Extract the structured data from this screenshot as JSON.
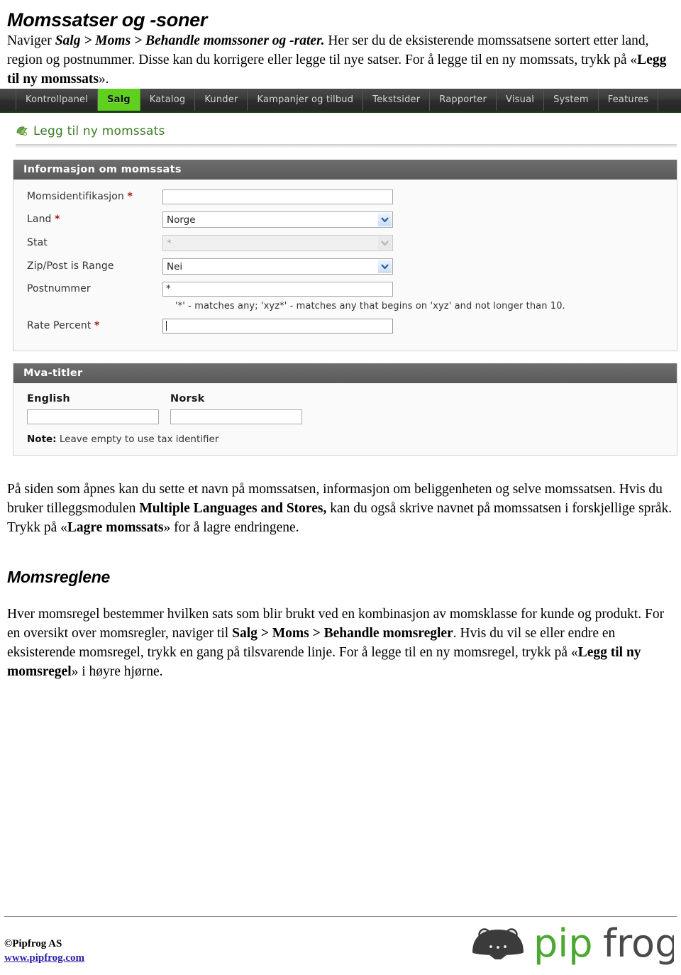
{
  "doc": {
    "title": "Momssatser og -soner",
    "intro": {
      "lead": "Naviger ",
      "path": "Salg > Moms > Behandle momssoner og -rater.",
      "rest": " Her ser du de eksisterende momssatsene sortert etter land, region og postnummer. Disse kan du korrigere eller legge til nye satser. For å legge til en ny momssats, trykk på «",
      "emph": "Legg til ny momssats",
      "tail": "»."
    },
    "mid_paragraph": {
      "part1": "På siden som åpnes kan du sette et navn på momssatsen, informasjon om beliggenheten og selve momssatsen. Hvis du bruker tilleggsmodulen ",
      "bold1": "Multiple Languages and Stores,",
      "part2": " kan du også skrive navnet på momssatsen i forskjellige språk. Trykk på «",
      "bold2": "Lagre momssats",
      "part3": "» for å lagre endringene."
    },
    "section2_title": "Momsreglene",
    "rules_paragraph": {
      "part1": "Hver momsregel bestemmer hvilken sats som blir brukt ved en kombinasjon av momsklasse for kunde og produkt. For en oversikt over momsregler, naviger til ",
      "bold1": "Salg > Moms > Behandle momsregler",
      "part2": ". Hvis du vil se eller endre en eksisterende momsregel, trykk en gang på tilsvarende linje. For å legge til en ny momsregel, trykk på «",
      "bold2": "Legg til ny momsregel",
      "part3": "» i høyre hjørne."
    }
  },
  "screenshot": {
    "nav": {
      "items": [
        {
          "label": "Kontrollpanel",
          "active": false
        },
        {
          "label": "Salg",
          "active": true
        },
        {
          "label": "Katalog",
          "active": false
        },
        {
          "label": "Kunder",
          "active": false
        },
        {
          "label": "Kampanjer og tilbud",
          "active": false
        },
        {
          "label": "Tekstsider",
          "active": false
        },
        {
          "label": "Rapporter",
          "active": false
        },
        {
          "label": "Visual",
          "active": false
        },
        {
          "label": "System",
          "active": false
        },
        {
          "label": "Features",
          "active": false
        }
      ],
      "active_color": "#5fd01f",
      "bar_color": "#3b3b3b"
    },
    "page_heading": {
      "icon": "leaf-icon",
      "title": "Legg til ny momssats"
    },
    "panel1": {
      "heading": "Informasjon om momssats",
      "fields": {
        "tax_identifier": {
          "label": "Momsidentifikasjon",
          "required": true,
          "value": "",
          "type": "text"
        },
        "country": {
          "label": "Land",
          "required": true,
          "value": "Norge",
          "type": "select"
        },
        "state": {
          "label": "Stat",
          "required": false,
          "value": "*",
          "type": "select",
          "disabled": true
        },
        "zip_range": {
          "label": "Zip/Post is Range",
          "required": false,
          "value": "Nei",
          "type": "select"
        },
        "zip_code": {
          "label": "Postnummer",
          "required": false,
          "value": "*",
          "type": "text"
        },
        "rate_percent": {
          "label": "Rate Percent",
          "required": true,
          "value": "",
          "type": "text",
          "focused": true
        }
      },
      "zip_hint": "'*' - matches any; 'xyz*' - matches any that begins on 'xyz' and not longer than 10."
    },
    "panel2": {
      "heading": "Mva-titler",
      "columns": [
        {
          "label": "English",
          "value": ""
        },
        {
          "label": "Norsk",
          "value": ""
        }
      ],
      "note_prefix": "Note:",
      "note_text": " Leave empty to use tax identifier"
    }
  },
  "footer": {
    "copyright": "©Pipfrog AS",
    "url": "www.pipfrog.com",
    "logo_text_pip": "pip",
    "logo_text_frog": "frog",
    "logo_green": "#4da832",
    "logo_dark": "#3b3b3b"
  }
}
